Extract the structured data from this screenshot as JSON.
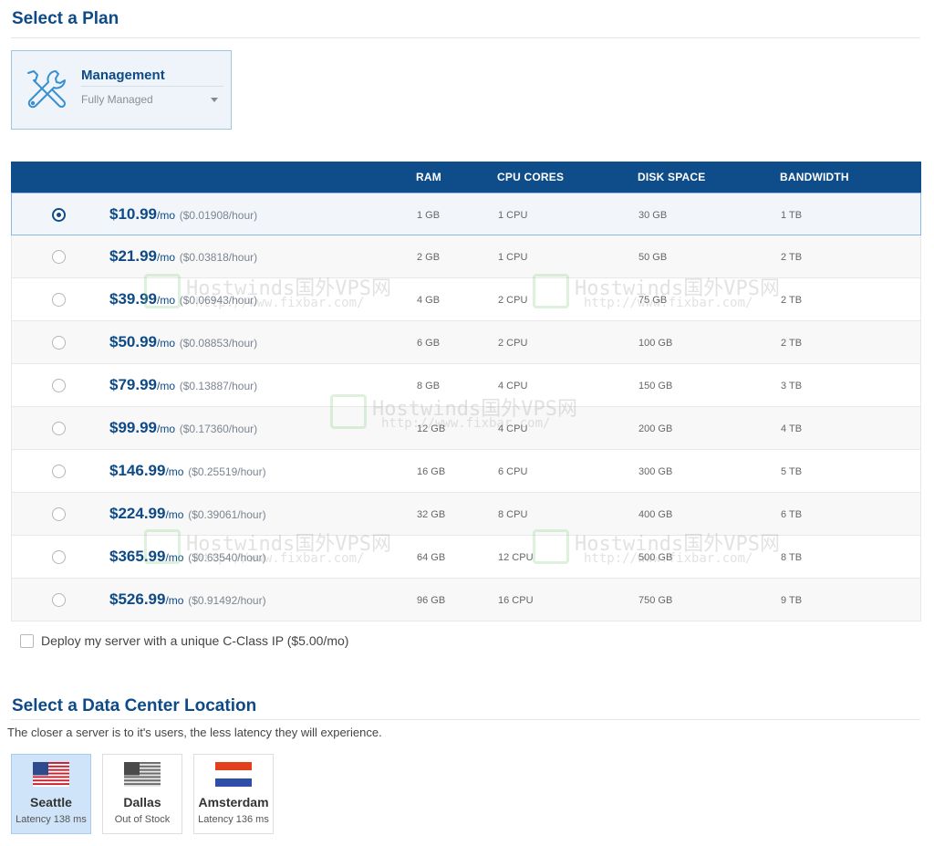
{
  "plan_section": {
    "title": "Select a Plan"
  },
  "management": {
    "title": "Management",
    "selected_option": "Fully Managed",
    "icon": "tools-icon"
  },
  "plans": {
    "headers": {
      "ram": "RAM",
      "cpu": "CPU CORES",
      "disk": "DISK SPACE",
      "bandwidth": "BANDWIDTH"
    },
    "rows": [
      {
        "price": "$10.99",
        "unit": "/mo",
        "hourly": "($0.01908/hour)",
        "ram": "1 GB",
        "cpu": "1 CPU",
        "disk": "30 GB",
        "bandwidth": "1 TB",
        "selected": true
      },
      {
        "price": "$21.99",
        "unit": "/mo",
        "hourly": "($0.03818/hour)",
        "ram": "2 GB",
        "cpu": "1 CPU",
        "disk": "50 GB",
        "bandwidth": "2 TB",
        "selected": false
      },
      {
        "price": "$39.99",
        "unit": "/mo",
        "hourly": "($0.06943/hour)",
        "ram": "4 GB",
        "cpu": "2 CPU",
        "disk": "75 GB",
        "bandwidth": "2 TB",
        "selected": false
      },
      {
        "price": "$50.99",
        "unit": "/mo",
        "hourly": "($0.08853/hour)",
        "ram": "6 GB",
        "cpu": "2 CPU",
        "disk": "100 GB",
        "bandwidth": "2 TB",
        "selected": false
      },
      {
        "price": "$79.99",
        "unit": "/mo",
        "hourly": "($0.13887/hour)",
        "ram": "8 GB",
        "cpu": "4 CPU",
        "disk": "150 GB",
        "bandwidth": "3 TB",
        "selected": false
      },
      {
        "price": "$99.99",
        "unit": "/mo",
        "hourly": "($0.17360/hour)",
        "ram": "12 GB",
        "cpu": "4 CPU",
        "disk": "200 GB",
        "bandwidth": "4 TB",
        "selected": false
      },
      {
        "price": "$146.99",
        "unit": "/mo",
        "hourly": "($0.25519/hour)",
        "ram": "16 GB",
        "cpu": "6 CPU",
        "disk": "300 GB",
        "bandwidth": "5 TB",
        "selected": false
      },
      {
        "price": "$224.99",
        "unit": "/mo",
        "hourly": "($0.39061/hour)",
        "ram": "32 GB",
        "cpu": "8 CPU",
        "disk": "400 GB",
        "bandwidth": "6 TB",
        "selected": false
      },
      {
        "price": "$365.99",
        "unit": "/mo",
        "hourly": "($0.63540/hour)",
        "ram": "64 GB",
        "cpu": "12 CPU",
        "disk": "500 GB",
        "bandwidth": "8 TB",
        "selected": false
      },
      {
        "price": "$526.99",
        "unit": "/mo",
        "hourly": "($0.91492/hour)",
        "ram": "96 GB",
        "cpu": "16 CPU",
        "disk": "750 GB",
        "bandwidth": "9 TB",
        "selected": false
      }
    ]
  },
  "cclass_option": {
    "label": "Deploy my server with a unique C-Class IP ($5.00/mo)",
    "checked": false
  },
  "datacenter_section": {
    "title": "Select a Data Center Location",
    "description": "The closer a server is to it's users, the less latency they will experience.",
    "locations": [
      {
        "city": "Seattle",
        "sub": "Latency 138 ms",
        "flag": "us-flag-icon",
        "selected": true
      },
      {
        "city": "Dallas",
        "sub": "Out of Stock",
        "flag": "us-flag-gray-icon",
        "selected": false
      },
      {
        "city": "Amsterdam",
        "sub": "Latency 136 ms",
        "flag": "nl-flag-icon",
        "selected": false
      }
    ]
  },
  "watermark": {
    "line1": "Hostwinds国外VPS网",
    "line2": "http://www.fixbar.com/"
  },
  "colors": {
    "accent": "#0f4c8a",
    "title": "#0d4a86",
    "selected_bg": "#cfe4f8"
  }
}
